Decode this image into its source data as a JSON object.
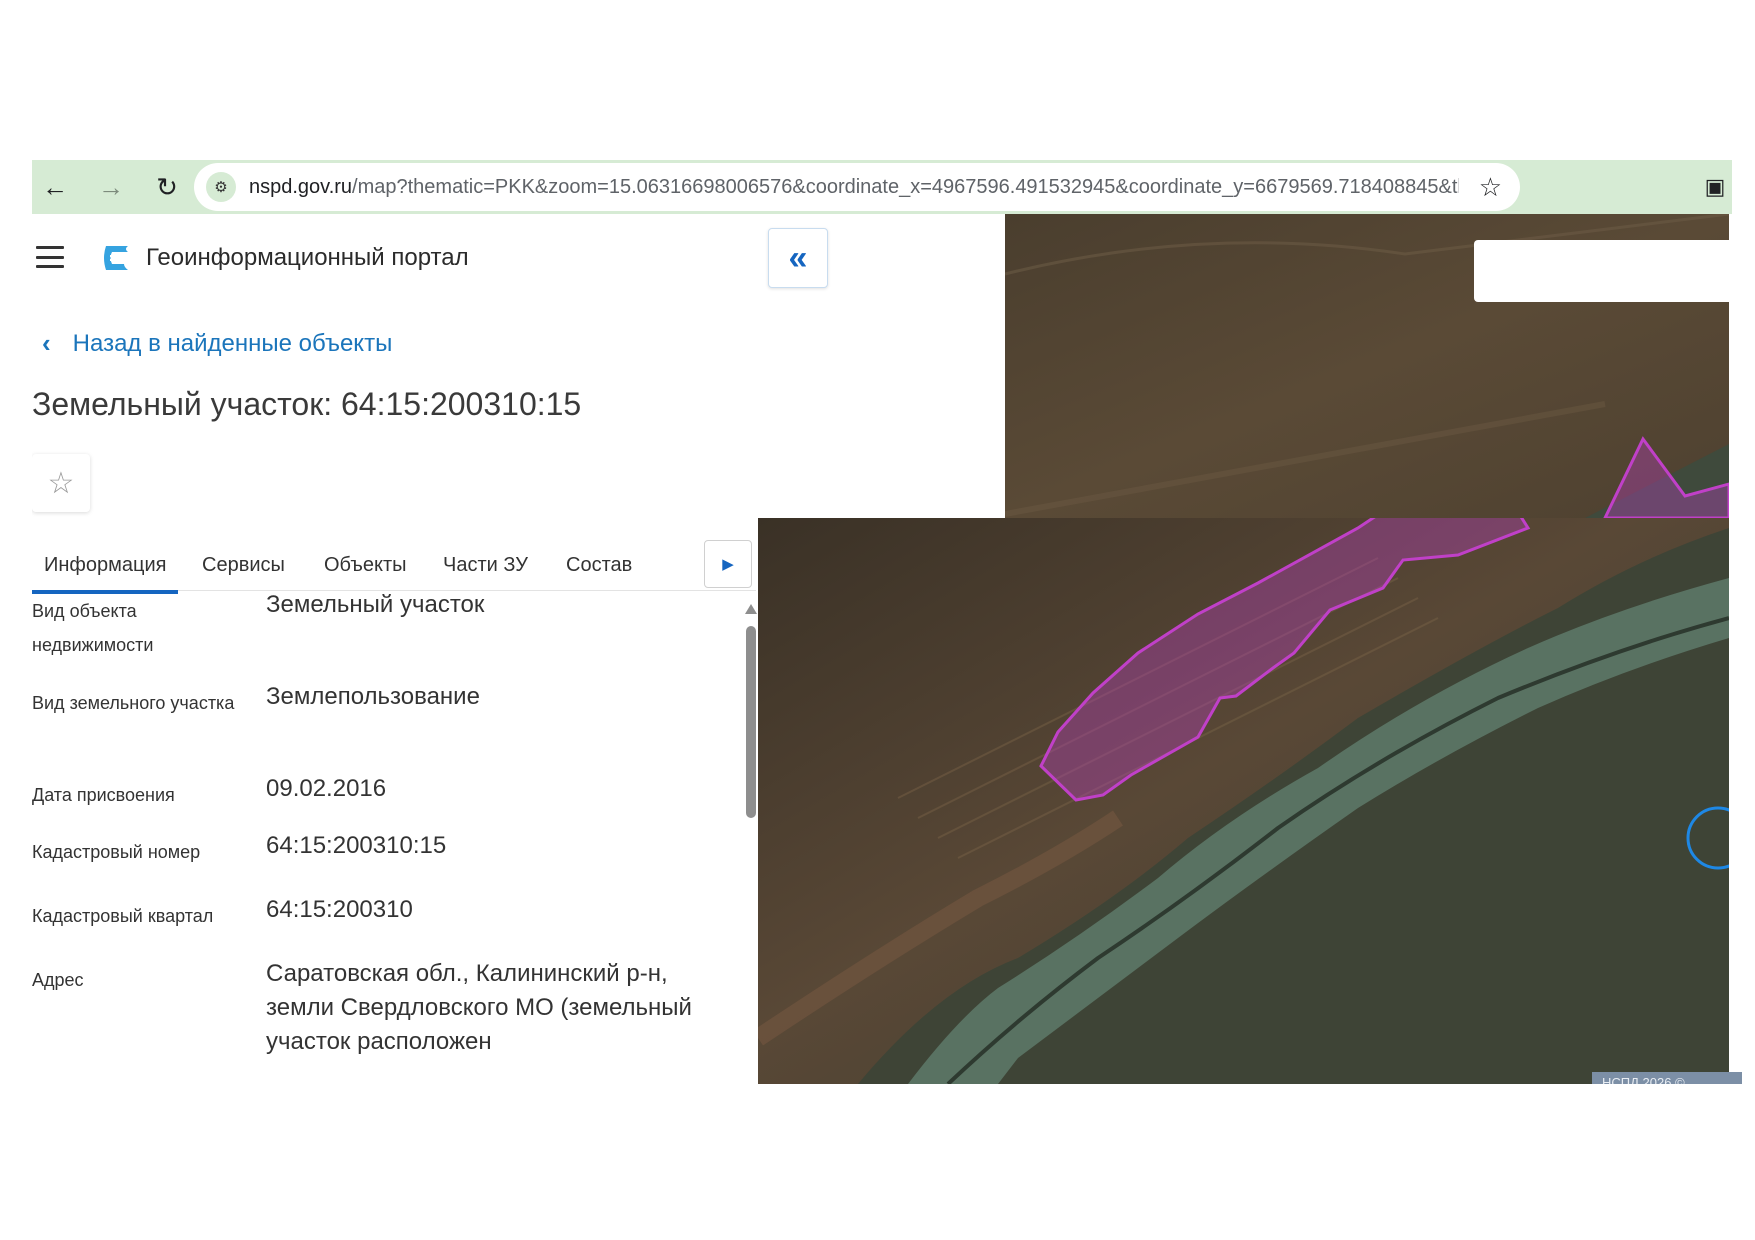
{
  "browser": {
    "url_host": "nspd.gov.ru",
    "url_rest": "/map?thematic=PKK&zoom=15.06316698006576&coordinate_x=4967596.491532945&coordinate_y=6679569.718408845&theme_id..."
  },
  "header": {
    "portal_title": "Геоинформационный портал"
  },
  "nav": {
    "back_label": "Назад в найденные объекты"
  },
  "object": {
    "title": "Земельный участок: 64:15:200310:15"
  },
  "tabs": [
    {
      "label": "Информация",
      "active": true
    },
    {
      "label": "Сервисы"
    },
    {
      "label": "Объекты"
    },
    {
      "label": "Части ЗУ"
    },
    {
      "label": "Состав"
    }
  ],
  "info": [
    {
      "label": "Вид объекта недвижимости",
      "value": "Земельный участок"
    },
    {
      "label": "Вид земельного участка",
      "value": "Землепользование"
    },
    {
      "label": "Дата присвоения",
      "value": "09.02.2016"
    },
    {
      "label": "Кадастровый номер",
      "value": "64:15:200310:15"
    },
    {
      "label": "Кадастровый квартал",
      "value": "64:15:200310"
    },
    {
      "label": "Адрес",
      "value": "Саратовская обл., Калининский р-н, земли Свердловского МО (земельный участок расположен"
    }
  ],
  "map": {
    "badge_text": "НСПД 2026 ©",
    "parcel_color": "#c040c8"
  },
  "colors": {
    "accent": "#1565c0",
    "link": "#1b75bb",
    "browser_bar": "#d6ebd4"
  },
  "icons": {
    "back": "arrow-left-icon",
    "forward": "arrow-right-icon",
    "reload": "reload-icon",
    "site_info": "tune-icon",
    "bookmark": "star-outline-icon",
    "extensions": "puzzle-icon",
    "menu": "hamburger-icon",
    "collapse": "double-chevron-left-icon",
    "favorite": "star-outline-icon",
    "tab_next": "triangle-right-icon"
  }
}
